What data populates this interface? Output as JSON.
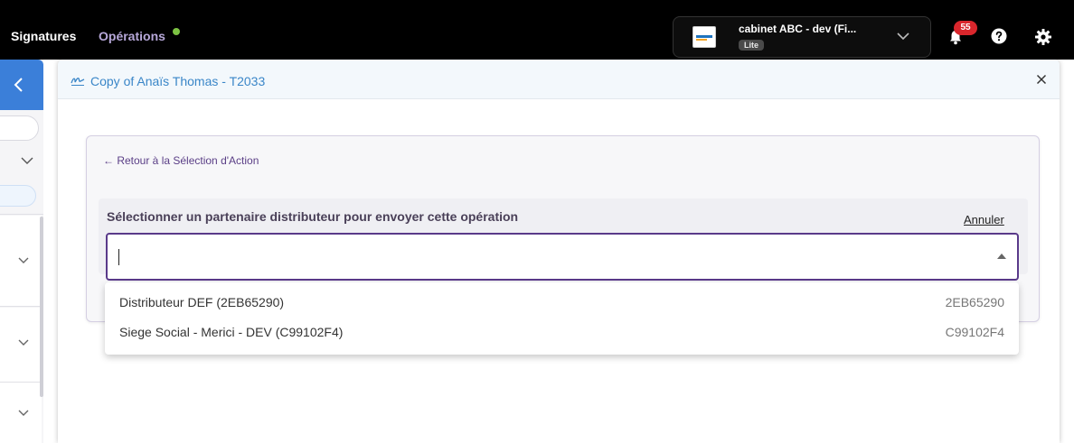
{
  "topbar": {
    "nav": [
      {
        "label": "Signatures",
        "active": true
      },
      {
        "label": "Opérations",
        "active": false,
        "status_color": "#7cc243"
      }
    ],
    "org": {
      "name": "cabinet ABC - dev (Fi...",
      "badge": "Lite"
    },
    "notifications": {
      "count": "55",
      "icon": "bell-icon"
    },
    "help_icon": "help-icon",
    "settings_icon": "gear-icon"
  },
  "sidebar": {
    "back_icon": "chevron-left-icon",
    "accent_color": "#3b7fd9"
  },
  "modal": {
    "title": "Copy of Anaïs Thomas - T2033",
    "title_icon": "signature-icon",
    "close_icon": "close-icon",
    "back_link": "← Retour à la Sélection d'Action",
    "select_label": "Sélectionner un partenaire distributeur pour envoyer cette opération",
    "cancel_label": "Annuler",
    "input_value": "",
    "options": [
      {
        "label": "Distributeur DEF (2EB65290)",
        "code": "2EB65290"
      },
      {
        "label": "Siege Social - Merici - DEV (C99102F4)",
        "code": "C99102F4"
      }
    ]
  },
  "colors": {
    "topbar_bg": "#000000",
    "modal_title": "#3a86c8",
    "focus_border": "#5a3a8a",
    "badge_red": "#d9262c"
  }
}
